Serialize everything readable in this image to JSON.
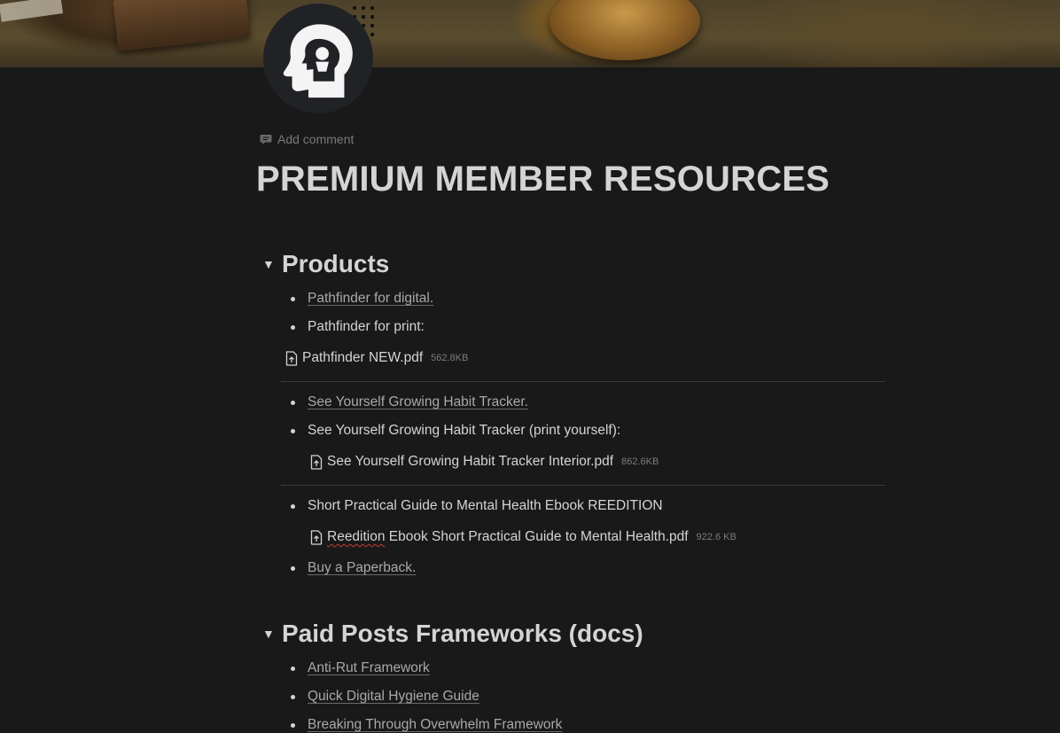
{
  "comment": {
    "label": "Add comment"
  },
  "page": {
    "title": "PREMIUM MEMBER RESOURCES"
  },
  "products": {
    "heading": "Products",
    "items": [
      {
        "label": "Pathfinder for digital."
      },
      {
        "label": "Pathfinder for print:"
      },
      {
        "file": "Pathfinder NEW.pdf",
        "size": "562.8KB"
      },
      {
        "label": "See Yourself Growing Habit Tracker."
      },
      {
        "label": "See Yourself Growing Habit Tracker (print yourself):"
      },
      {
        "file": "See Yourself Growing Habit Tracker Interior.pdf",
        "size": "862.6KB"
      },
      {
        "label": "Short Practical Guide to Mental Health Ebook REEDITION"
      },
      {
        "file_prefix": "Reedition",
        "file_rest": " Ebook Short Practical Guide to Mental Health.pdf",
        "size": "922.6 KB"
      },
      {
        "label": "Buy a Paperback."
      }
    ]
  },
  "paid_posts": {
    "heading": "Paid Posts Frameworks (docs)",
    "items": [
      {
        "label": "Anti-Rut Framework"
      },
      {
        "label": "Quick Digital Hygiene Guide"
      },
      {
        "label": "Breaking Through Overwhelm Framework"
      }
    ]
  },
  "colors": {
    "background": "#191919",
    "text": "#d4d4d4",
    "muted": "#7a7a7a"
  },
  "icons": {
    "page": "head-silhouette-icon",
    "comment": "comment-icon",
    "toggle": "triangle-down-icon",
    "file": "file-upload-icon"
  }
}
